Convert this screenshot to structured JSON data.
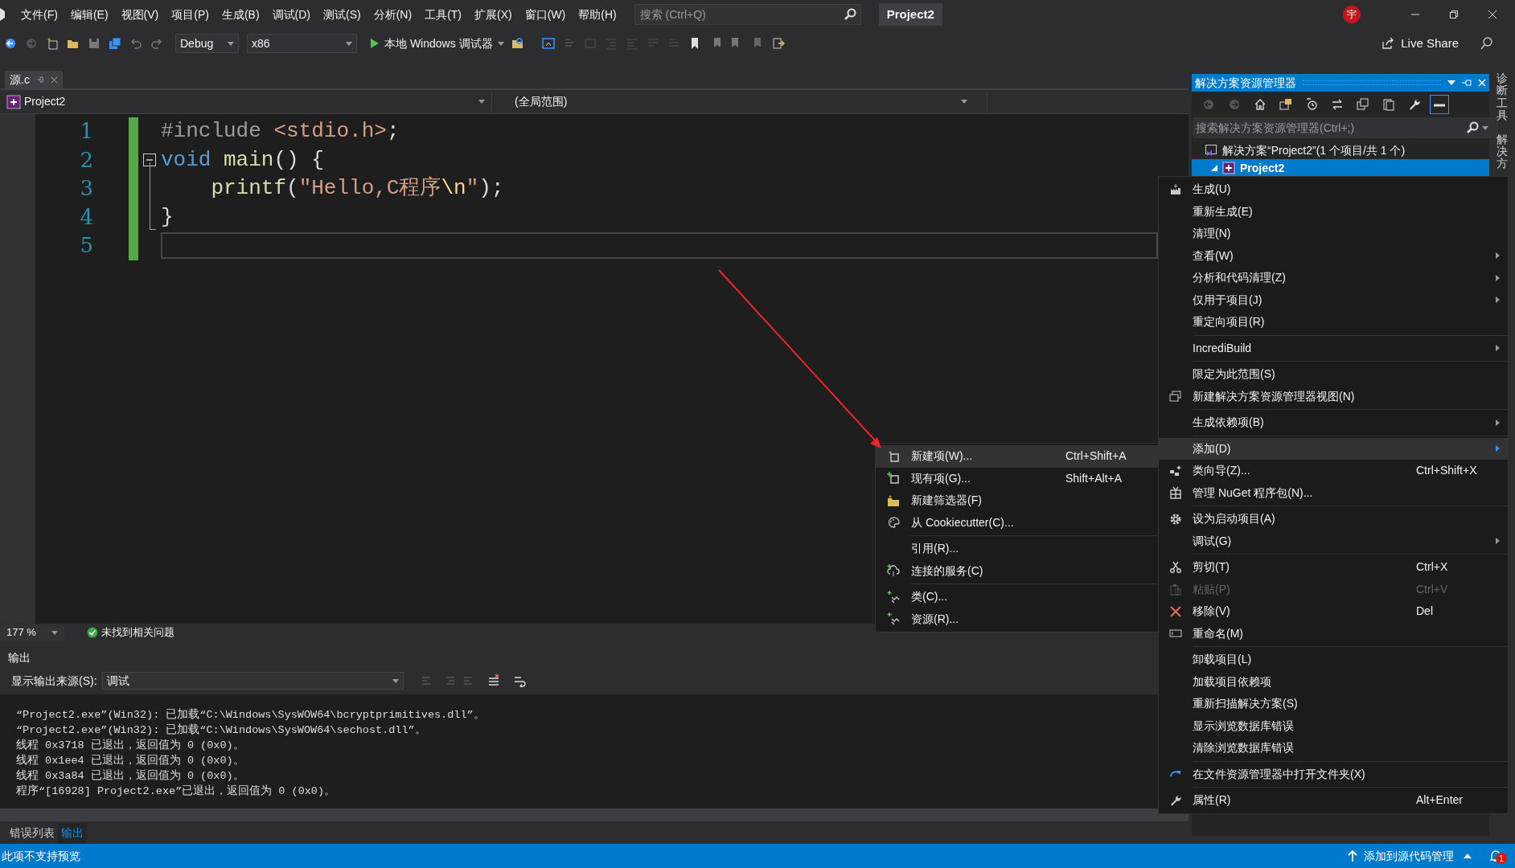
{
  "menu_bar": [
    "文件(F)",
    "编辑(E)",
    "视图(V)",
    "项目(P)",
    "生成(B)",
    "调试(D)",
    "测试(S)",
    "分析(N)",
    "工具(T)",
    "扩展(X)",
    "窗口(W)",
    "帮助(H)"
  ],
  "search": {
    "placeholder": "搜索 (Ctrl+Q)"
  },
  "project_title": "Project2",
  "user_badge": "宇",
  "toolbar": {
    "configuration": "Debug",
    "platform": "x86",
    "run_label": "本地 Windows 调试器",
    "live_share": "Live Share"
  },
  "document_tabs": [
    {
      "label": "源.c",
      "selected": true
    }
  ],
  "nav_bar": {
    "project": "Project2",
    "scope": "(全局范围)"
  },
  "editor": {
    "lines": [
      {
        "number": "1",
        "collapsible": false,
        "current": false,
        "tokens": [
          {
            "kind": "preprocessor",
            "text": "#include "
          },
          {
            "kind": "string",
            "text": "<stdio.h>"
          },
          {
            "kind": "plain",
            "text": ";"
          }
        ]
      },
      {
        "number": "2",
        "collapsible": true,
        "current": false,
        "tokens": [
          {
            "kind": "keyword",
            "text": "void "
          },
          {
            "kind": "function",
            "text": "main"
          },
          {
            "kind": "plain",
            "text": "() {"
          }
        ]
      },
      {
        "number": "3",
        "collapsible": false,
        "current": false,
        "tokens": [
          {
            "kind": "function",
            "text": "    printf"
          },
          {
            "kind": "plain",
            "text": "("
          },
          {
            "kind": "string",
            "text": "\"Hello,C程序"
          },
          {
            "kind": "escape",
            "text": "\\n"
          },
          {
            "kind": "string",
            "text": "\""
          },
          {
            "kind": "plain",
            "text": ");"
          }
        ]
      },
      {
        "number": "4",
        "collapsible": false,
        "current": false,
        "tokens": [
          {
            "kind": "plain",
            "text": "}"
          }
        ]
      },
      {
        "number": "5",
        "collapsible": false,
        "current": true
      }
    ]
  },
  "zoom_bar": {
    "zoom": "177 %",
    "issues": "未找到相关问题"
  },
  "output": {
    "title": "输出",
    "source_label": "显示输出来源(S):",
    "source": "调试",
    "lines": [
      "“Project2.exe”(Win32): 已加载“C:\\Windows\\SysWOW64\\bcryptprimitives.dll”。",
      "“Project2.exe”(Win32): 已加载“C:\\Windows\\SysWOW64\\sechost.dll”。",
      "线程 0x3718 已退出，返回值为 0 (0x0)。",
      "线程 0x1ee4 已退出，返回值为 0 (0x0)。",
      "线程 0x3a84 已退出，返回值为 0 (0x0)。",
      "程序“[16928] Project2.exe”已退出，返回值为 0 (0x0)。"
    ]
  },
  "bottom_tabs": [
    {
      "label": "错误列表",
      "selected": false
    },
    {
      "label": "输出",
      "selected": true
    }
  ],
  "status_bar": {
    "left": "此项不支持预览",
    "right": "添加到源代码管理",
    "notifications": "1"
  },
  "solution_explorer": {
    "title": "解决方案资源管理器",
    "search_placeholder": "搜索解决方案资源管理器(Ctrl+;)",
    "tree": [
      {
        "label": "解决方案“Project2”(1 个项目/共 1 个)",
        "selected": false,
        "children": [
          {
            "label": "Project2",
            "selected": true
          }
        ]
      }
    ]
  },
  "side_tabs": [
    "诊断工具",
    "解决方"
  ],
  "context_menu": {
    "items": [
      {
        "kind": "item",
        "label": "生成(U)",
        "has_submenu": false,
        "selected": false,
        "disabled": false
      },
      {
        "kind": "item",
        "label": "重新生成(E)",
        "has_submenu": false,
        "selected": false,
        "disabled": false
      },
      {
        "kind": "item",
        "label": "清理(N)",
        "has_submenu": false,
        "selected": false,
        "disabled": false
      },
      {
        "kind": "item",
        "label": "查看(W)",
        "has_submenu": true,
        "selected": false,
        "disabled": false
      },
      {
        "kind": "item",
        "label": "分析和代码清理(Z)",
        "has_submenu": true,
        "selected": false,
        "disabled": false
      },
      {
        "kind": "item",
        "label": "仅用于项目(J)",
        "has_submenu": true,
        "selected": false,
        "disabled": false
      },
      {
        "kind": "item",
        "label": "重定向项目(R)",
        "has_submenu": false,
        "selected": false,
        "disabled": false
      },
      {
        "kind": "separator"
      },
      {
        "kind": "item",
        "label": "IncrediBuild",
        "has_submenu": true,
        "selected": false,
        "disabled": false
      },
      {
        "kind": "separator"
      },
      {
        "kind": "item",
        "label": "限定为此范围(S)",
        "has_submenu": false,
        "selected": false,
        "disabled": false
      },
      {
        "kind": "item",
        "label": "新建解决方案资源管理器视图(N)",
        "has_submenu": false,
        "selected": false,
        "disabled": false
      },
      {
        "kind": "separator"
      },
      {
        "kind": "item",
        "label": "生成依赖项(B)",
        "has_submenu": true,
        "selected": false,
        "disabled": false
      },
      {
        "kind": "separator"
      },
      {
        "kind": "item",
        "label": "添加(D)",
        "has_submenu": true,
        "selected": true,
        "disabled": false
      },
      {
        "kind": "item",
        "label": "类向导(Z)...",
        "shortcut": "Ctrl+Shift+X",
        "has_submenu": false,
        "selected": false,
        "disabled": false
      },
      {
        "kind": "item",
        "label": "管理 NuGet 程序包(N)...",
        "has_submenu": false,
        "selected": false,
        "disabled": false
      },
      {
        "kind": "separator"
      },
      {
        "kind": "item",
        "label": "设为启动项目(A)",
        "has_submenu": false,
        "selected": false,
        "disabled": false
      },
      {
        "kind": "item",
        "label": "调试(G)",
        "has_submenu": true,
        "selected": false,
        "disabled": false
      },
      {
        "kind": "separator"
      },
      {
        "kind": "item",
        "label": "剪切(T)",
        "shortcut": "Ctrl+X",
        "has_submenu": false,
        "selected": false,
        "disabled": false
      },
      {
        "kind": "item",
        "label": "粘贴(P)",
        "shortcut": "Ctrl+V",
        "has_submenu": false,
        "selected": false,
        "disabled": true
      },
      {
        "kind": "item",
        "label": "移除(V)",
        "shortcut": "Del",
        "has_submenu": false,
        "selected": false,
        "disabled": false
      },
      {
        "kind": "item",
        "label": "重命名(M)",
        "has_submenu": false,
        "selected": false,
        "disabled": false
      },
      {
        "kind": "separator"
      },
      {
        "kind": "item",
        "label": "卸载项目(L)",
        "has_submenu": false,
        "selected": false,
        "disabled": false
      },
      {
        "kind": "item",
        "label": "加载项目依赖项",
        "has_submenu": false,
        "selected": false,
        "disabled": false
      },
      {
        "kind": "item",
        "label": "重新扫描解决方案(S)",
        "has_submenu": false,
        "selected": false,
        "disabled": false
      },
      {
        "kind": "item",
        "label": "显示浏览数据库错误",
        "has_submenu": false,
        "selected": false,
        "disabled": false
      },
      {
        "kind": "item",
        "label": "清除浏览数据库错误",
        "has_submenu": false,
        "selected": false,
        "disabled": false
      },
      {
        "kind": "separator"
      },
      {
        "kind": "item",
        "label": "在文件资源管理器中打开文件夹(X)",
        "has_submenu": false,
        "selected": false,
        "disabled": false
      },
      {
        "kind": "separator"
      },
      {
        "kind": "item",
        "label": "属性(R)",
        "shortcut": "Alt+Enter",
        "has_submenu": false,
        "selected": false,
        "disabled": false
      }
    ]
  },
  "add_submenu": {
    "items": [
      {
        "kind": "item",
        "label": "新建项(W)...",
        "shortcut": "Ctrl+Shift+A",
        "selected": true
      },
      {
        "kind": "item",
        "label": "现有项(G)...",
        "shortcut": "Shift+Alt+A",
        "selected": false
      },
      {
        "kind": "item",
        "label": "新建筛选器(F)",
        "selected": false
      },
      {
        "kind": "item",
        "label": "从 Cookiecutter(C)...",
        "selected": false
      },
      {
        "kind": "separator"
      },
      {
        "kind": "item",
        "label": "引用(R)...",
        "selected": false
      },
      {
        "kind": "item",
        "label": "连接的服务(C)",
        "selected": false
      },
      {
        "kind": "separator"
      },
      {
        "kind": "item",
        "label": "类(C)...",
        "selected": false
      },
      {
        "kind": "item",
        "label": "资源(R)...",
        "selected": false
      }
    ]
  }
}
